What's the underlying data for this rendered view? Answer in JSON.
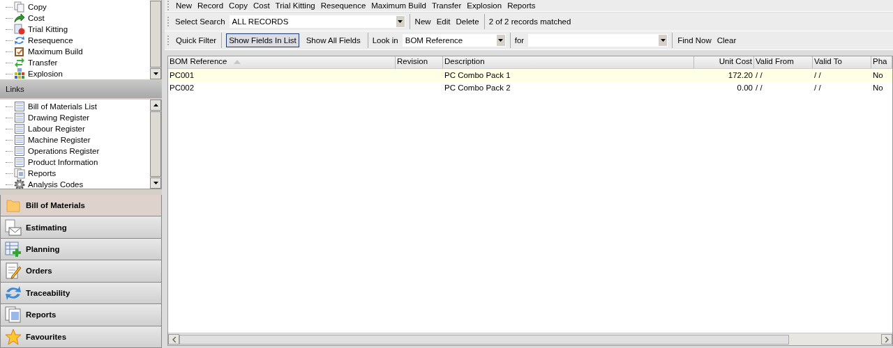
{
  "tasks": {
    "items": [
      {
        "label": "Copy"
      },
      {
        "label": "Cost"
      },
      {
        "label": "Trial Kitting"
      },
      {
        "label": "Resequence"
      },
      {
        "label": "Maximum Build"
      },
      {
        "label": "Transfer"
      },
      {
        "label": "Explosion"
      }
    ]
  },
  "links": {
    "title": "Links",
    "items": [
      {
        "label": "Bill of Materials List"
      },
      {
        "label": "Drawing Register"
      },
      {
        "label": "Labour Register"
      },
      {
        "label": "Machine Register"
      },
      {
        "label": "Operations Register"
      },
      {
        "label": "Product Information"
      },
      {
        "label": "Reports"
      },
      {
        "label": "Analysis Codes"
      }
    ]
  },
  "nav": [
    {
      "label": "Bill of Materials",
      "selected": true
    },
    {
      "label": "Estimating",
      "selected": false
    },
    {
      "label": "Planning",
      "selected": false
    },
    {
      "label": "Orders",
      "selected": false
    },
    {
      "label": "Traceability",
      "selected": false
    },
    {
      "label": "Reports",
      "selected": false
    },
    {
      "label": "Favourites",
      "selected": false
    }
  ],
  "menu": [
    "New",
    "Record",
    "Copy",
    "Cost",
    "Trial Kitting",
    "Resequence",
    "Maximum Build",
    "Transfer",
    "Explosion",
    "Reports"
  ],
  "search_bar": {
    "label": "Select Search",
    "value": "ALL RECORDS",
    "actions": [
      "New",
      "Edit",
      "Delete"
    ],
    "status": "2 of 2 records matched"
  },
  "filter_bar": {
    "quick_filter": "Quick Filter",
    "toggles": [
      {
        "label": "Show Fields In List",
        "selected": true
      },
      {
        "label": "Show All Fields",
        "selected": false
      }
    ],
    "look_in_label": "Look in",
    "look_in": "BOM Reference",
    "for_label": "for",
    "find": "Find Now",
    "clear": "Clear"
  },
  "table": {
    "columns": [
      "BOM Reference",
      "Revision",
      "Description",
      "Unit Cost",
      "Valid From",
      "Valid To",
      "Pha"
    ],
    "rows": [
      {
        "selected": true,
        "cells": [
          "PC001",
          "",
          "PC Combo Pack 1",
          "172.20",
          "/ /",
          "/ /",
          "No"
        ]
      },
      {
        "selected": false,
        "cells": [
          "PC002",
          "",
          "PC Combo Pack 2",
          "0.00",
          "/ /",
          "/ /",
          "No"
        ]
      }
    ]
  }
}
